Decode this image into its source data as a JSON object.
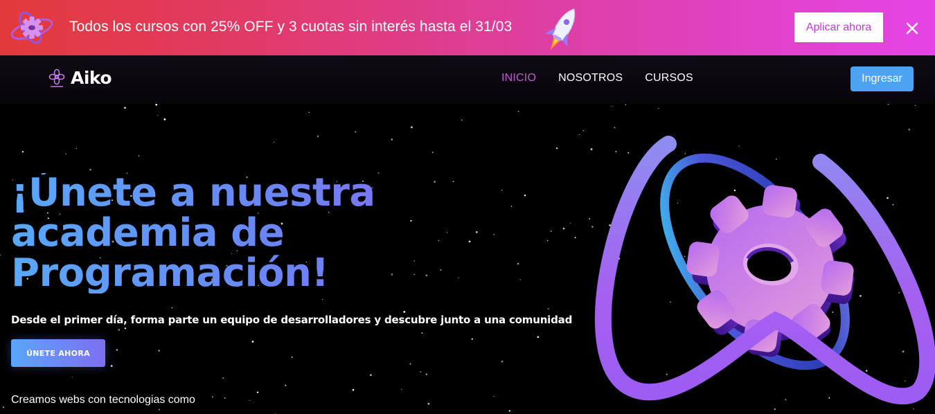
{
  "promo": {
    "text": "Todos los cursos con 25% OFF y 3 cuotas sin interés hasta el 31/03",
    "apply_label": "Aplicar ahora",
    "logo_icon": "atom-gear-icon",
    "rocket_icon": "rocket-icon",
    "close_icon": "close-icon"
  },
  "nav": {
    "brand": "Aiko",
    "brand_icon": "flower-logo-icon",
    "links": [
      {
        "label": "INICIO",
        "active": true
      },
      {
        "label": "NOSOTROS",
        "active": false
      },
      {
        "label": "CURSOS",
        "active": false
      }
    ],
    "login_label": "Ingresar"
  },
  "hero": {
    "title_lines": [
      "¡Únete a nuestra",
      "academia de",
      "Programación!"
    ],
    "subtitle": "Desde el primer día, forma parte un equipo de desarrolladores y descubre junto a una comunidad",
    "cta_label": "ÚNETE AHORA",
    "tech_caption": "Creamos webs con tecnologias como",
    "illustration_icon": "atom-gear-illustration"
  },
  "colors": {
    "banner_start": "#e23a3a",
    "banner_end": "#e544e6",
    "nav_active": "#c45ad8",
    "login_button": "#4ba3f2",
    "title_start": "#58a8f8",
    "title_end": "#8a6af0",
    "gear": "#c77fe6"
  }
}
